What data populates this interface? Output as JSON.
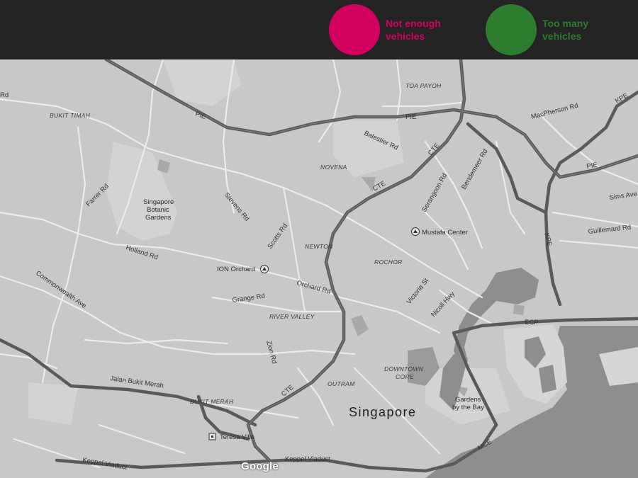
{
  "legend": {
    "items": [
      {
        "label": "Not enough vehicles",
        "line1": "Not enough",
        "line2": "vehicles",
        "color": "#d3005f"
      },
      {
        "label": "Too many vehicles",
        "line1": "Too many",
        "line2": "vehicles",
        "color": "#2e7d2e"
      }
    ]
  },
  "map": {
    "style": "grayscale",
    "city_label": "Singapore",
    "attribution": "Google",
    "roads": {
      "pie_1": "PIE",
      "pie_2": "PIE",
      "pie_3": "PIE",
      "bukit_timah_rd": "Rd",
      "macpherson_rd": "MacPherson Rd",
      "kpe_1": "KPE",
      "kpe_2": "KPE",
      "balestier_rd": "Balestier Rd",
      "cte_1": "CTE",
      "cte_2": "CTE",
      "cte_3": "CTE",
      "farrer_rd": "Farrer Rd",
      "stevens_rd": "Stevens Rd",
      "serangoon_rd": "Serangoon Rd",
      "bendemeer_rd": "Bendemeer Rd",
      "sims_ave": "Sims Ave",
      "guillemard_rd": "Guillemard Rd",
      "scotts_rd": "Scotts Rd",
      "holland_rd": "Holland Rd",
      "orchard_rd": "Orchard Rd",
      "grange_rd": "Grange Rd",
      "victoria_st": "Victoria St",
      "nicoll_hwy": "Nicoll Hwy",
      "commonwealth_ave": "Commonwealth Ave",
      "ecp": "ECP",
      "zion_rd": "Zion Rd",
      "jalan_bukit_merah": "Jalan Bukit Merah",
      "mce": "MCE",
      "keppel_viaduct_1": "Keppel Viaduct",
      "keppel_viaduct_2": "Keppel Viaduct"
    },
    "areas": {
      "bukit_timah": "BUKIT TIMAH",
      "toa_payoh": "TOA PAYOH",
      "novena": "NOVENA",
      "newton": "NEWTON",
      "rochor": "ROCHOR",
      "river_valley": "RIVER VALLEY",
      "downtown_core_1": "DOWNTOWN",
      "downtown_core_2": "CORE",
      "outram": "OUTRAM",
      "bukit_merah": "BUKIT MERAH"
    },
    "pois": {
      "botanic_1": "Singapore",
      "botanic_2": "Botanic",
      "botanic_3": "Gardens",
      "ion_orchard": "ION Orchard",
      "mustafa_center": "Mustafa Center",
      "gardens_bay_1": "Gardens",
      "gardens_bay_2": "by the Bay",
      "teresa_ville": "Teresa Ville"
    }
  }
}
